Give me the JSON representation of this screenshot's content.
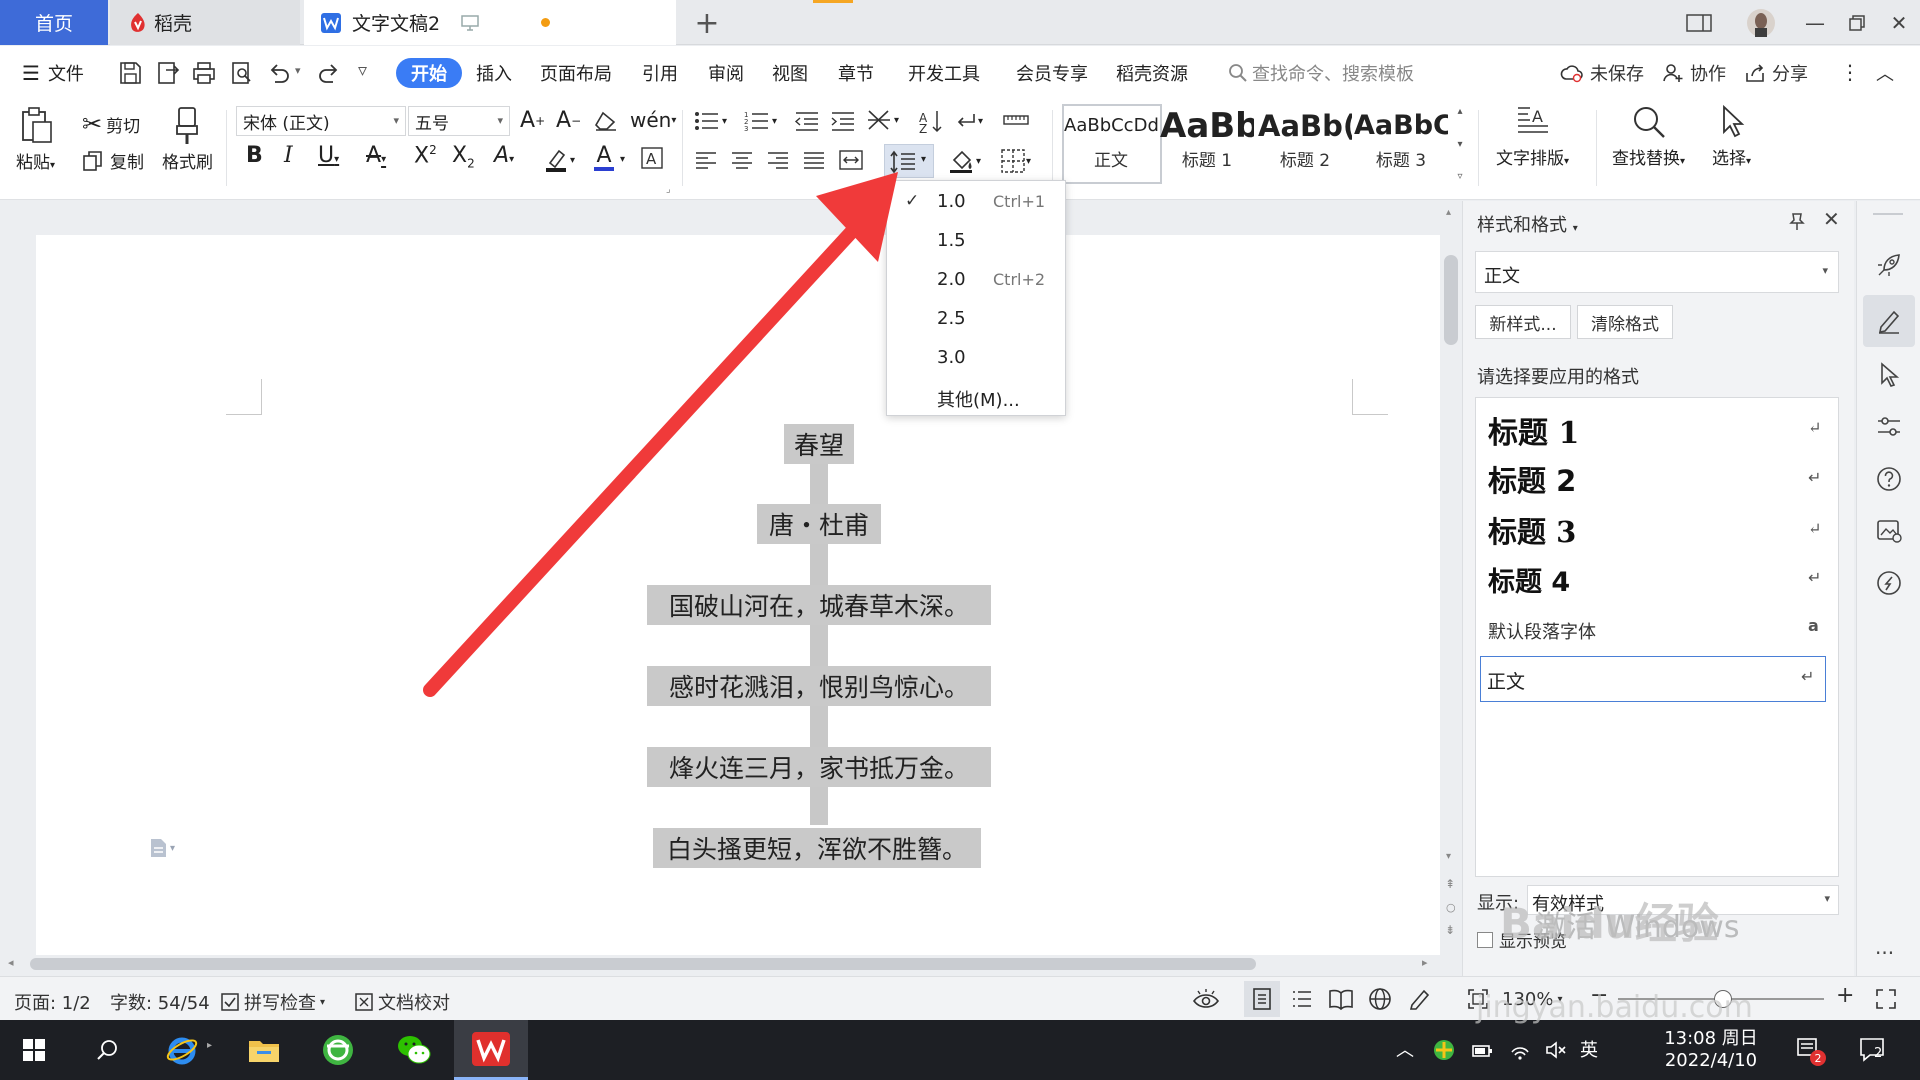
{
  "titlebar": {
    "tabs": [
      {
        "label": "首页"
      },
      {
        "label": "稻壳"
      },
      {
        "label": "文字文稿2"
      }
    ],
    "add_tab": "+"
  },
  "menubar": {
    "file": "文件",
    "items": [
      "开始",
      "插入",
      "页面布局",
      "引用",
      "审阅",
      "视图",
      "章节",
      "开发工具",
      "会员专享",
      "稻壳资源"
    ],
    "search_placeholder": "查找命令、搜索模板",
    "unsaved": "未保存",
    "collab": "协作",
    "share": "分享"
  },
  "ribbon": {
    "paste": "粘贴",
    "cut": "剪切",
    "copy": "复制",
    "format_painter": "格式刷",
    "font_name": "宋体 (正文)",
    "font_size": "五号",
    "styles": [
      {
        "preview": "AaBbCcDd",
        "name": "正文"
      },
      {
        "preview": "AaBb",
        "name": "标题 1"
      },
      {
        "preview": "AaBb(",
        "name": "标题 2"
      },
      {
        "preview": "AaBbC",
        "name": "标题 3"
      }
    ],
    "text_layout": "文字排版",
    "find_replace": "查找替换",
    "select": "选择"
  },
  "line_spacing_menu": {
    "items": [
      {
        "value": "1.0",
        "shortcut": "Ctrl+1",
        "checked": true
      },
      {
        "value": "1.5",
        "shortcut": ""
      },
      {
        "value": "2.0",
        "shortcut": "Ctrl+2"
      },
      {
        "value": "2.5",
        "shortcut": ""
      },
      {
        "value": "3.0",
        "shortcut": ""
      },
      {
        "value": "其他(M)...",
        "shortcut": ""
      }
    ]
  },
  "document": {
    "lines": [
      "春望",
      "唐・杜甫",
      "国破山河在，城春草木深。",
      "感时花溅泪，恨别鸟惊心。",
      "烽火连三月，家书抵万金。",
      "白头搔更短，浑欲不胜簪。"
    ]
  },
  "style_panel": {
    "title": "样式和格式",
    "current_style": "正文",
    "new_style": "新样式...",
    "clear_format": "清除格式",
    "apply_label": "请选择要应用的格式",
    "items": [
      {
        "label": "标题  1",
        "mark": "↵"
      },
      {
        "label": "标题  2",
        "mark": "↵"
      },
      {
        "label": "标题  3",
        "mark": "↵"
      },
      {
        "label": "标题  4",
        "mark": "↵"
      },
      {
        "label": "默认段落字体",
        "mark": "a"
      },
      {
        "label": "正文",
        "mark": "↵"
      }
    ],
    "show_label": "显示:",
    "show_value": "有效样式",
    "preview_label": "显示预览"
  },
  "statusbar": {
    "page": "页面: 1/2",
    "words": "字数: 54/54",
    "spellcheck": "拼写检查",
    "doc_check": "文档校对",
    "zoom": "130%"
  },
  "taskbar": {
    "ime": "英",
    "time": "13:08 周日",
    "date": "2022/4/10",
    "notif_count": "2",
    "badge": "2"
  },
  "watermark": {
    "main": "Baidu经验",
    "sub": "jingyan.baidu.com",
    "activate": "激活 Windows"
  },
  "colors": {
    "accent": "#3a7cf5",
    "home_tab": "#3e6bd8",
    "arrow": "#f03a3a",
    "highlight": "#c9c9c9"
  }
}
